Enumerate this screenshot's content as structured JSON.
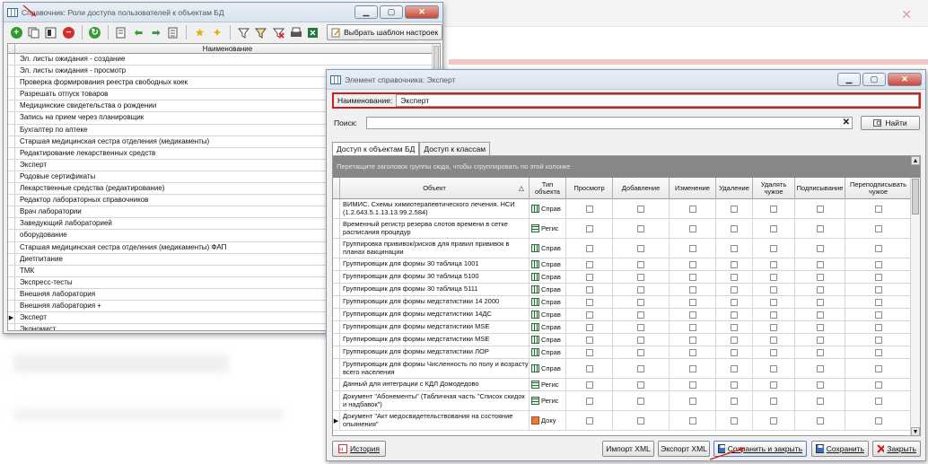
{
  "win1": {
    "title": "Справочник: Роли доступа пользователей к объектам БД",
    "template_button": "Выбрать шаблон настроек",
    "column_header": "Наименование",
    "items": [
      "Эл. листы ожидания - создание",
      "Эл. листы ожидания - просмотр",
      "Проверка формирования реестра свободных коек",
      "Разрешать отпуск товаров",
      "Медицинские свидетельства о рождении",
      "Запись на прием через планировщик",
      "Бухгалтер по аптеке",
      "Старшая медицинская сестра отделения (медикаменты)",
      "Редактирование лекарственных средств",
      "Эксперт",
      "Родовые сертификаты",
      "Лекарственные средства (редактирование)",
      "Редактор лабораторных справочников",
      "Врач лаборатории",
      "Заведующий лабораторией",
      "оборудование",
      "Старшая медицинская сестра отделения (медикаменты) ФАП",
      "Диетпитание",
      "ТМК",
      "Экспресс-тесты",
      "Внешняя лаборатория",
      "Внешняя лаборатория +",
      "Эксперт",
      "Экономист"
    ],
    "current_row_marker": "▶",
    "current_row_index": 22
  },
  "win2": {
    "title": "Элемент справочника: Эксперт",
    "name_label": "Наименование:",
    "name_value": "Эксперт",
    "search_label": "Поиск:",
    "search_clear": "✕",
    "find_button": "Найти",
    "tabs": [
      "Доступ к объектам БД",
      "Доступ к классам"
    ],
    "group_hint": "Перетащите заголовок группы сюда, чтобы сгруппировать по этой колонке",
    "columns": [
      "Объект",
      "Тип объекта",
      "Просмотр",
      "Добавление",
      "Изменение",
      "Удаление",
      "Удалять чужое",
      "Подписывание",
      "Переподписывать чужое"
    ],
    "sort_marker": "△",
    "rows": [
      {
        "obj": "ВИМИС. Схемы химиотерапевтического лечения. НСИ (1.2.643.5.1.13.13.99.2.584)",
        "type": "Справ",
        "kind": "ref"
      },
      {
        "obj": "Временный регистр резерва слотов времени в сетке расписания процедур",
        "type": "Регис",
        "kind": "reg"
      },
      {
        "obj": "Группировка прививок/рисков для правил прививок в планах вакцинации",
        "type": "Справ",
        "kind": "ref"
      },
      {
        "obj": "Группировщик для формы 30 таблица 1001",
        "type": "Справ",
        "kind": "ref"
      },
      {
        "obj": "Группировщик для формы 30 таблица 5100",
        "type": "Справ",
        "kind": "ref"
      },
      {
        "obj": "Группировщик для формы 30 таблица 5111",
        "type": "Справ",
        "kind": "ref"
      },
      {
        "obj": "Группировщик для формы медстатистики 14 2000",
        "type": "Справ",
        "kind": "ref"
      },
      {
        "obj": "Группировщик для формы медстатистики 14ДС",
        "type": "Справ",
        "kind": "ref"
      },
      {
        "obj": "Группировщик для формы медстатистики MSE",
        "type": "Справ",
        "kind": "ref"
      },
      {
        "obj": "Группировщик для формы медстатистики MSE",
        "type": "Справ",
        "kind": "ref"
      },
      {
        "obj": "Группировщик для формы медстатистики ЛОР",
        "type": "Справ",
        "kind": "ref"
      },
      {
        "obj": "Группировщик для формы Численность по полу и возрасту всего населения",
        "type": "Справ",
        "kind": "ref"
      },
      {
        "obj": "Данный для интеграции с КДЛ Домодедово",
        "type": "Регис",
        "kind": "reg"
      },
      {
        "obj": "Документ \"Абонементы\" (Табличная часть \"Список скидок и надбавок\")",
        "type": "Регис",
        "kind": "reg"
      },
      {
        "obj": "Документ \"Акт медосвидетельствования на состояние опьянения\"",
        "type": "Доку",
        "kind": "doc"
      }
    ],
    "current_row_marker": "▶",
    "footer": {
      "history": "История",
      "import_xml": "Импорт XML",
      "export_xml": "Экспорт XML",
      "save_close": "Сохранить и закрыть",
      "save": "Сохранить",
      "close": "Закрыть"
    }
  }
}
